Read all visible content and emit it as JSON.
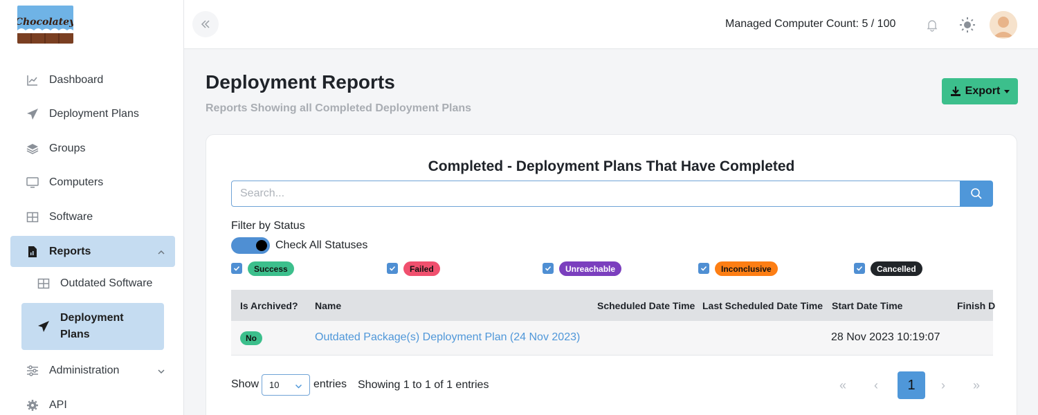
{
  "app": {
    "logo_text": "Chocolatey"
  },
  "sidebar": {
    "items": [
      {
        "label": "Dashboard",
        "icon": "chart-line-icon"
      },
      {
        "label": "Deployment Plans",
        "icon": "paper-plane-icon"
      },
      {
        "label": "Groups",
        "icon": "layers-icon"
      },
      {
        "label": "Computers",
        "icon": "monitor-icon"
      },
      {
        "label": "Software",
        "icon": "grid-icon"
      },
      {
        "label": "Reports",
        "icon": "file-report-icon",
        "active": true,
        "expanded": true
      },
      {
        "label": "Administration",
        "icon": "sliders-icon"
      },
      {
        "label": "API",
        "icon": "gear-icon"
      }
    ],
    "reports_subitems": [
      {
        "label": "Outdated Software",
        "icon": "grid-icon"
      },
      {
        "label": "Deployment Plans",
        "icon": "paper-plane-icon",
        "active": true
      }
    ]
  },
  "topbar": {
    "managed_count": "Managed Computer Count: 5 / 100"
  },
  "page": {
    "title": "Deployment Reports",
    "subtitle": "Reports Showing all Completed Deployment Plans",
    "export_label": "Export"
  },
  "card": {
    "title": "Completed - Deployment Plans That Have Completed",
    "search_placeholder": "Search...",
    "filter_label": "Filter by Status",
    "check_all_label": "Check All Statuses",
    "statuses": [
      {
        "label": "Success",
        "color": "#3cbf8c",
        "text_color": "#111111",
        "checked": true
      },
      {
        "label": "Failed",
        "color": "#f0506e",
        "text_color": "#111111",
        "checked": true
      },
      {
        "label": "Unreachable",
        "color": "#7b3fbe",
        "text_color": "#ffffff",
        "checked": true
      },
      {
        "label": "Inconclusive",
        "color": "#fd7e14",
        "text_color": "#111111",
        "checked": true
      },
      {
        "label": "Cancelled",
        "color": "#212529",
        "text_color": "#ffffff",
        "checked": true
      }
    ]
  },
  "table": {
    "columns": [
      "Is Archived?",
      "Name",
      "Scheduled Date Time",
      "Last Scheduled Date Time",
      "Start Date Time",
      "Finish D"
    ],
    "rows": [
      {
        "archived": "No",
        "name": "Outdated Package(s) Deployment Plan (24 Nov 2023)",
        "scheduled": "",
        "last_scheduled": "",
        "start": "28 Nov 2023 10:19:07"
      }
    ]
  },
  "footer": {
    "show_label": "Show",
    "page_length": "10",
    "entries_label": "entries",
    "info": "Showing 1 to 1 of 1 entries",
    "current_page": "1",
    "first_glyph": "«",
    "prev_glyph": "‹",
    "next_glyph": "›",
    "last_glyph": "»"
  },
  "colors": {
    "accent": "#4f97d9",
    "active_nav_bg": "#c5dcf1",
    "export_bg": "#3cbf8c"
  }
}
